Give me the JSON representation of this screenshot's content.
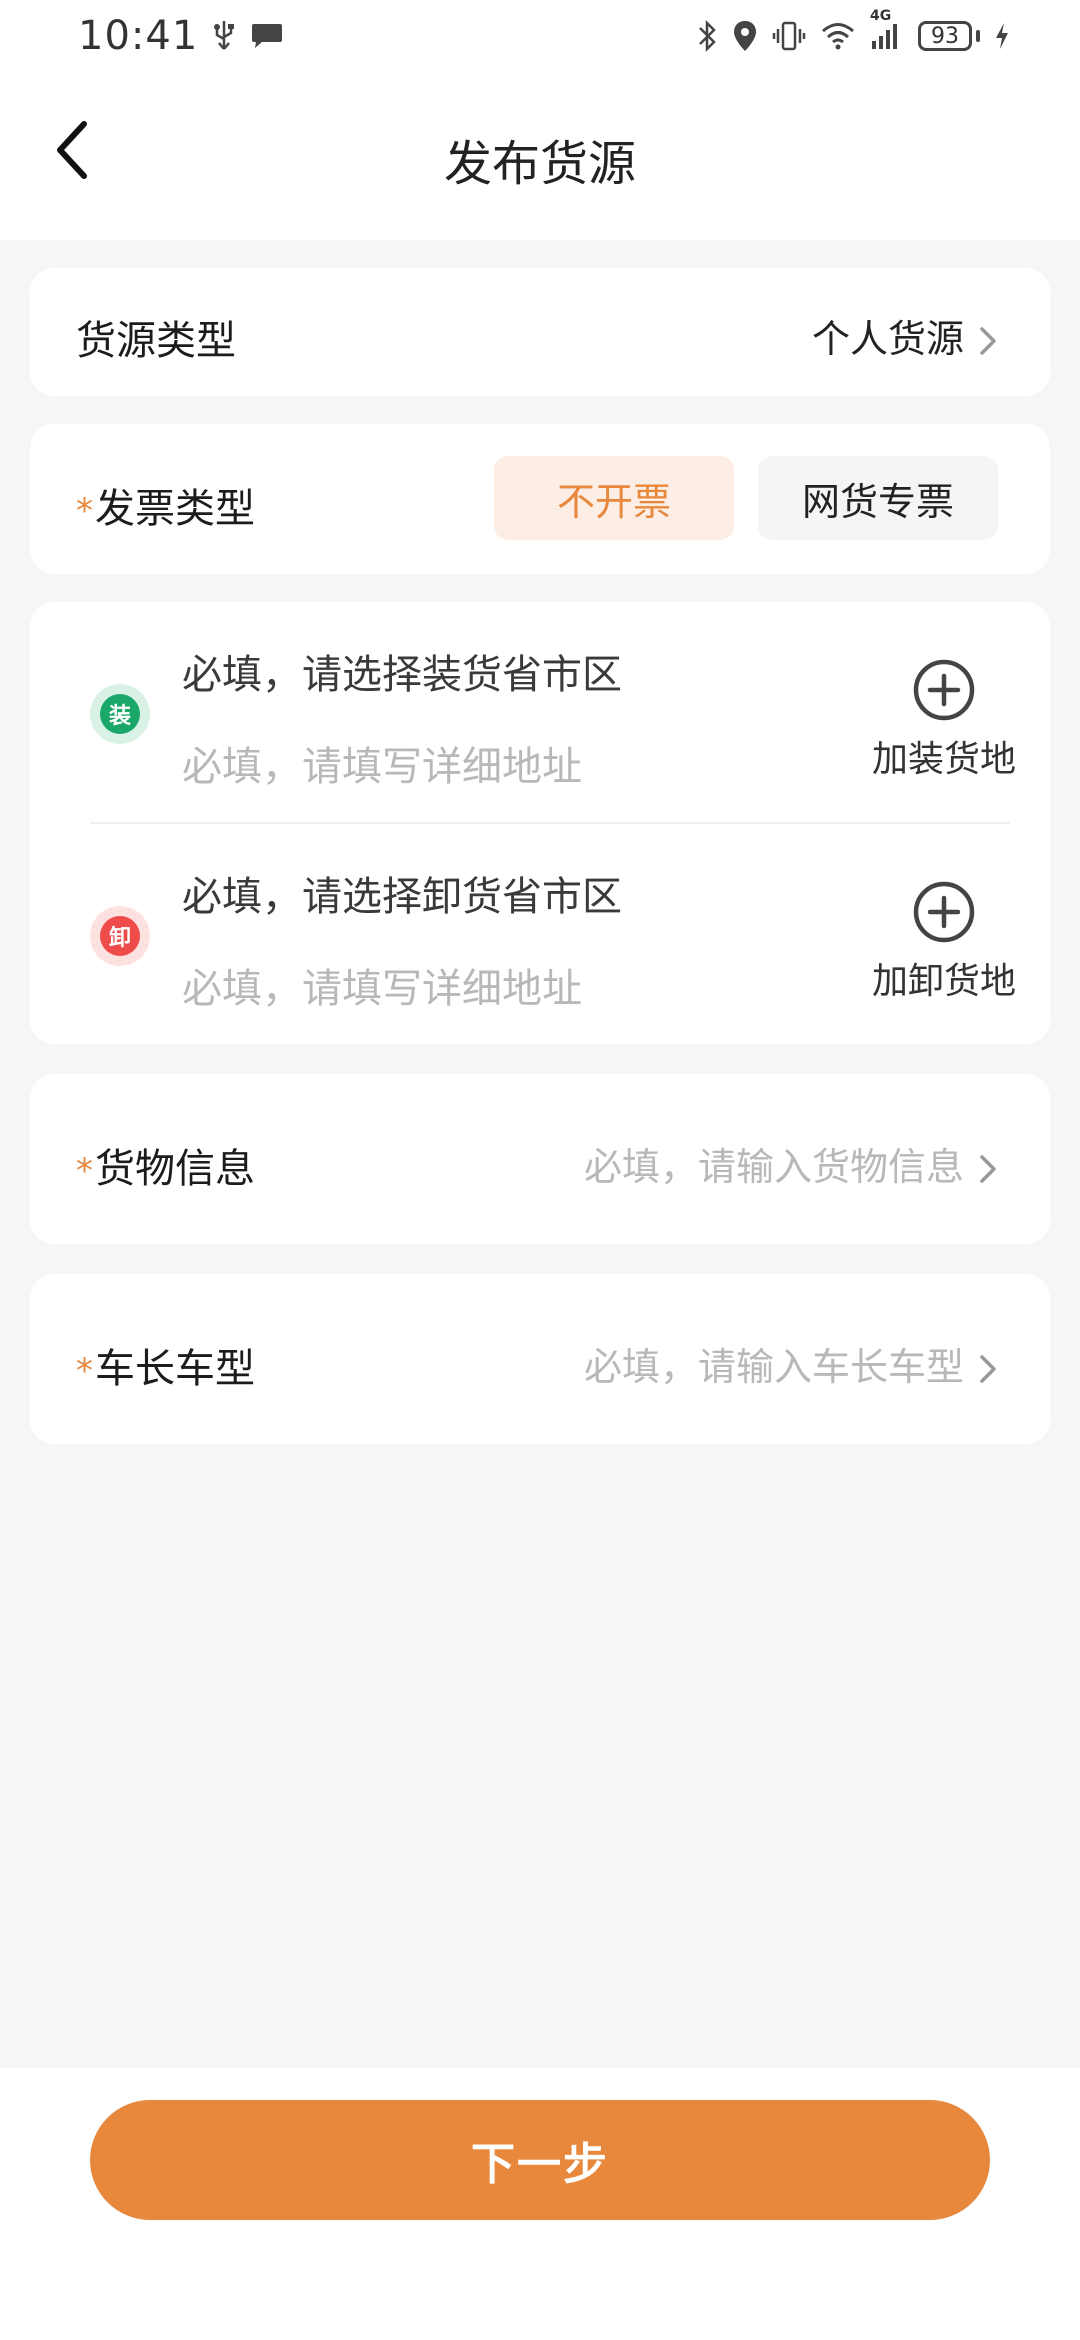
{
  "status_bar": {
    "time": "10:41",
    "battery": "93",
    "network": "4G",
    "icons": [
      "usb-icon",
      "message-icon",
      "bluetooth-icon",
      "location-icon",
      "vibrate-icon",
      "wifi-icon",
      "signal-icon",
      "battery-icon",
      "charging-icon"
    ]
  },
  "header": {
    "title": "发布货源",
    "back_icon": "back-arrow-icon"
  },
  "source_type": {
    "label": "货源类型",
    "value": "个人货源"
  },
  "invoice": {
    "required_mark": "*",
    "label": "发票类型",
    "options": [
      "不开票",
      "网货专票"
    ],
    "selected": "不开票"
  },
  "address": {
    "load": {
      "badge": "装",
      "region_placeholder": "必填，请选择装货省市区",
      "detail_placeholder": "必填，请填写详细地址",
      "add_label": "加装货地"
    },
    "unload": {
      "badge": "卸",
      "region_placeholder": "必填，请选择卸货省市区",
      "detail_placeholder": "必填，请填写详细地址",
      "add_label": "加卸货地"
    }
  },
  "goods": {
    "required_mark": "*",
    "label": "货物信息",
    "placeholder": "必填，请输入货物信息"
  },
  "vehicle": {
    "required_mark": "*",
    "label": "车长车型",
    "placeholder": "必填，请输入车长车型"
  },
  "footer": {
    "next_label": "下一步"
  },
  "colors": {
    "accent": "#e8883d",
    "accent_light": "#fceee4",
    "load_green": "#1aa86a",
    "unload_red": "#ee4b4b",
    "placeholder": "#b8b8b8"
  }
}
